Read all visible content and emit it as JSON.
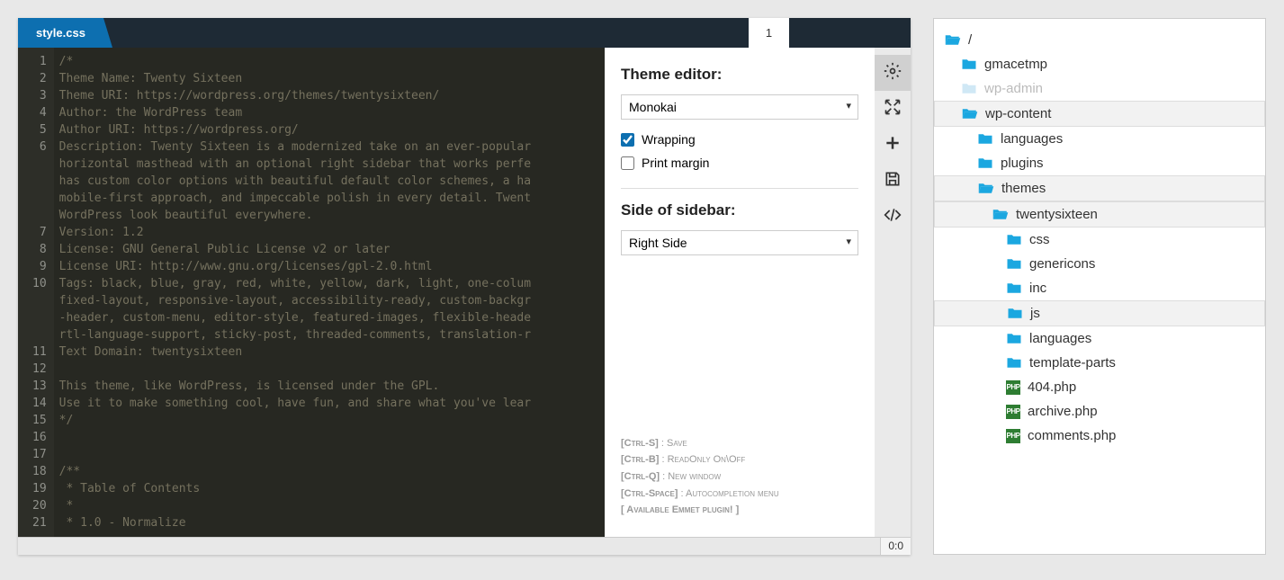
{
  "tab": {
    "filename": "style.css",
    "cursor_line": "1"
  },
  "status": {
    "position": "0:0"
  },
  "settings": {
    "theme_heading": "Theme editor:",
    "theme_value": "Monokai",
    "wrapping_label": "Wrapping",
    "wrapping_checked": true,
    "printmargin_label": "Print margin",
    "printmargin_checked": false,
    "sidebar_heading": "Side of sidebar:",
    "sidebar_value": "Right Side"
  },
  "shortcuts": [
    {
      "keys": "[Ctrl-S]",
      "desc": "Save"
    },
    {
      "keys": "[Ctrl-B]",
      "desc": "ReadOnly On\\Off"
    },
    {
      "keys": "[Ctrl-Q]",
      "desc": "New window"
    },
    {
      "keys": "[Ctrl-Space]",
      "desc": "Autocompletion menu"
    },
    {
      "keys": "",
      "desc": "[ Available Emmet plugin! ]"
    }
  ],
  "gutter": [
    "1",
    "2",
    "3",
    "4",
    "5",
    "6",
    "",
    "",
    "",
    "",
    "7",
    "8",
    "9",
    "10",
    "",
    "",
    "",
    "11",
    "12",
    "13",
    "14",
    "15",
    "16",
    "17",
    "18",
    "19",
    "20",
    "21"
  ],
  "code": "/*\nTheme Name: Twenty Sixteen\nTheme URI: https://wordpress.org/themes/twentysixteen/\nAuthor: the WordPress team\nAuthor URI: https://wordpress.org/\nDescription: Twenty Sixteen is a modernized take on an ever-popular\nhorizontal masthead with an optional right sidebar that works perfe\nhas custom color options with beautiful default color schemes, a ha\nmobile-first approach, and impeccable polish in every detail. Twent\nWordPress look beautiful everywhere.\nVersion: 1.2\nLicense: GNU General Public License v2 or later\nLicense URI: http://www.gnu.org/licenses/gpl-2.0.html\nTags: black, blue, gray, red, white, yellow, dark, light, one-colum\nfixed-layout, responsive-layout, accessibility-ready, custom-backgr\n-header, custom-menu, editor-style, featured-images, flexible-heade\nrtl-language-support, sticky-post, threaded-comments, translation-r\nText Domain: twentysixteen\n\nThis theme, like WordPress, is licensed under the GPL.\nUse it to make something cool, have fun, and share what you've lear\n*/\n\n\n/**\n * Table of Contents\n *\n * 1.0 - Normalize",
  "tree": [
    {
      "label": "/",
      "type": "folder-open",
      "depth": 0
    },
    {
      "label": "gmacetmp",
      "type": "folder",
      "depth": 1
    },
    {
      "label": "wp-admin",
      "type": "folder",
      "depth": 1,
      "muted": true
    },
    {
      "label": "wp-content",
      "type": "folder-open",
      "depth": 1,
      "selected": true
    },
    {
      "label": "languages",
      "type": "folder",
      "depth": 2
    },
    {
      "label": "plugins",
      "type": "folder",
      "depth": 2
    },
    {
      "label": "themes",
      "type": "folder-open",
      "depth": 2,
      "selected": true
    },
    {
      "label": "twentysixteen",
      "type": "folder-open",
      "depth": 3,
      "selected": true
    },
    {
      "label": "css",
      "type": "folder",
      "depth": 4
    },
    {
      "label": "genericons",
      "type": "folder",
      "depth": 4
    },
    {
      "label": "inc",
      "type": "folder",
      "depth": 4
    },
    {
      "label": "js",
      "type": "folder",
      "depth": 4,
      "selected": true
    },
    {
      "label": "languages",
      "type": "folder",
      "depth": 4
    },
    {
      "label": "template-parts",
      "type": "folder",
      "depth": 4
    },
    {
      "label": "404.php",
      "type": "php",
      "depth": 4
    },
    {
      "label": "archive.php",
      "type": "php",
      "depth": 4
    },
    {
      "label": "comments.php",
      "type": "php",
      "depth": 4
    }
  ]
}
